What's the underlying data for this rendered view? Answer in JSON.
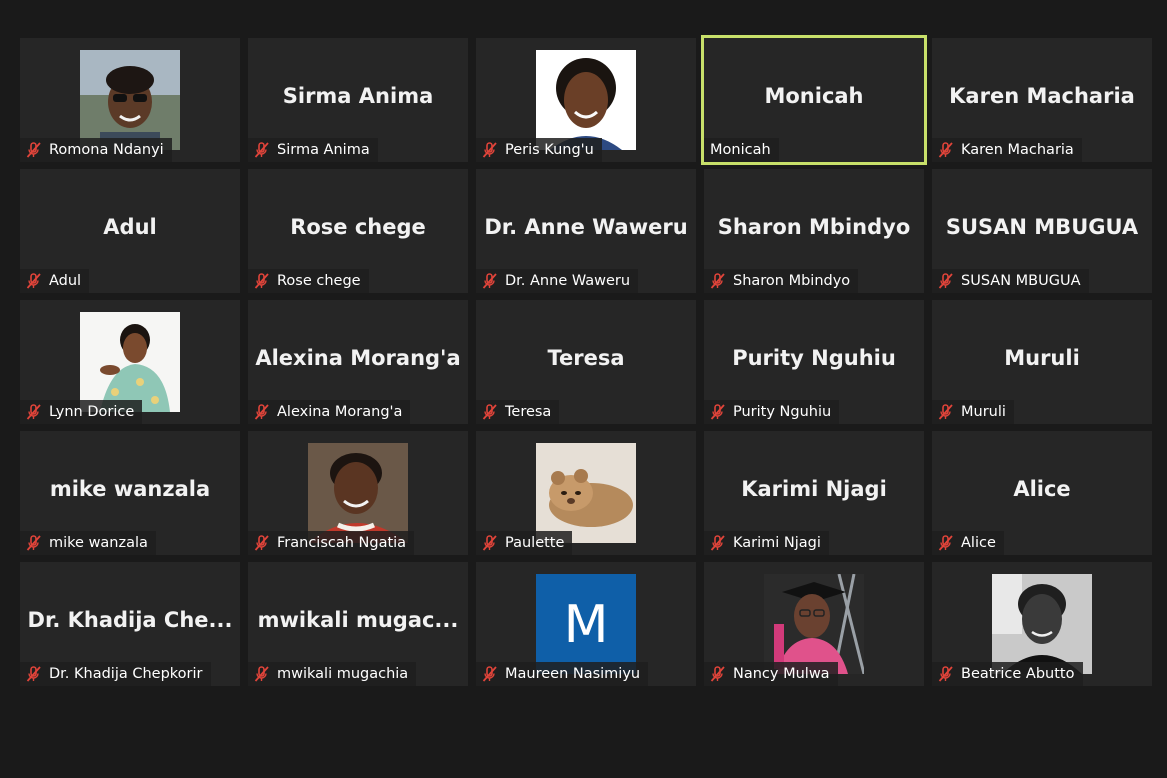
{
  "participants": [
    {
      "name": "Romona Ndanyi",
      "display": "",
      "avatar": "photo-woman-glasses",
      "muted": true,
      "active": false
    },
    {
      "name": "Sirma Anima",
      "display": "Sirma Anima",
      "avatar": "",
      "muted": true,
      "active": false
    },
    {
      "name": "Peris Kung'u",
      "display": "",
      "avatar": "photo-woman-smiling",
      "muted": true,
      "active": false
    },
    {
      "name": "Monicah",
      "display": "Monicah",
      "avatar": "",
      "muted": false,
      "active": true
    },
    {
      "name": "Karen Macharia",
      "display": "Karen Macharia",
      "avatar": "",
      "muted": true,
      "active": false
    },
    {
      "name": "Adul",
      "display": "Adul",
      "avatar": "",
      "muted": true,
      "active": false
    },
    {
      "name": "Rose chege",
      "display": "Rose chege",
      "avatar": "",
      "muted": true,
      "active": false
    },
    {
      "name": "Dr. Anne Waweru",
      "display": "Dr. Anne Waweru",
      "avatar": "",
      "muted": true,
      "active": false
    },
    {
      "name": "Sharon Mbindyo",
      "display": "Sharon Mbindyo",
      "avatar": "",
      "muted": true,
      "active": false
    },
    {
      "name": "SUSAN MBUGUA",
      "display": "SUSAN MBUGUA",
      "avatar": "",
      "muted": true,
      "active": false
    },
    {
      "name": "Lynn Dorice",
      "display": "",
      "avatar": "photo-woman-floral",
      "muted": true,
      "active": false
    },
    {
      "name": "Alexina Morang'a",
      "display": "Alexina Morang'a",
      "avatar": "",
      "muted": true,
      "active": false
    },
    {
      "name": "Teresa",
      "display": "Teresa",
      "avatar": "",
      "muted": true,
      "active": false
    },
    {
      "name": "Purity Nguhiu",
      "display": "Purity Nguhiu",
      "avatar": "",
      "muted": true,
      "active": false
    },
    {
      "name": "Muruli",
      "display": "Muruli",
      "avatar": "",
      "muted": true,
      "active": false
    },
    {
      "name": "mike wanzala",
      "display": "mike wanzala",
      "avatar": "",
      "muted": true,
      "active": false
    },
    {
      "name": "Franciscah Ngatia",
      "display": "",
      "avatar": "photo-woman-red",
      "muted": true,
      "active": false
    },
    {
      "name": "Paulette",
      "display": "",
      "avatar": "photo-lion-cub",
      "muted": true,
      "active": false
    },
    {
      "name": "Karimi Njagi",
      "display": "Karimi Njagi",
      "avatar": "",
      "muted": true,
      "active": false
    },
    {
      "name": "Alice",
      "display": "Alice",
      "avatar": "",
      "muted": true,
      "active": false
    },
    {
      "name": "Dr. Khadija Chepkorir",
      "display": "Dr.  Khadija  Che...",
      "avatar": "",
      "muted": true,
      "active": false
    },
    {
      "name": "mwikali mugachia",
      "display": "mwikali  mugac...",
      "avatar": "",
      "muted": true,
      "active": false
    },
    {
      "name": "Maureen Nasimiyu",
      "display": "",
      "avatar": "letter-M",
      "initial": "M",
      "muted": true,
      "active": false
    },
    {
      "name": "Nancy Mulwa",
      "display": "",
      "avatar": "photo-woman-graduation",
      "muted": true,
      "active": false
    },
    {
      "name": "Beatrice Abutto",
      "display": "",
      "avatar": "photo-woman-bw",
      "muted": true,
      "active": false
    }
  ],
  "colors": {
    "background": "#1a1a1a",
    "tile": "#262626",
    "active_border": "#c8e06a",
    "mute_icon": "#e0443a",
    "letter_avatar_bg": "#0f5fa8"
  }
}
